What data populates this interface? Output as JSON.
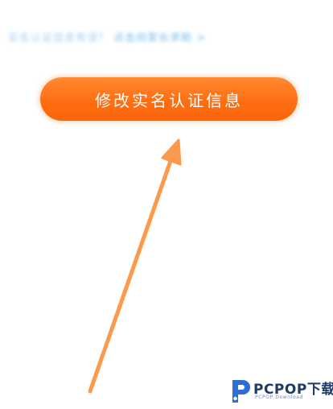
{
  "hint": {
    "text": "实名认证信息有误？",
    "link": "点击向家长求助",
    "chevron": ">"
  },
  "button": {
    "label": "修改实名认证信息"
  },
  "annotation": {
    "icon": "arrow-up-icon",
    "color": "#fb9a4c"
  },
  "watermark": {
    "brand": "PCPOP",
    "brand_cn": "下载",
    "sub": "PCPOP Download"
  },
  "colors": {
    "button": "#ff7a1f",
    "hint": "#8fc6f4",
    "watermark": "#1f3a66"
  }
}
